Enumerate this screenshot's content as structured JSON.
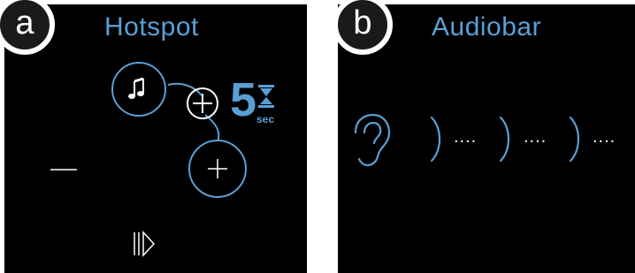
{
  "panel_a": {
    "badge": "a",
    "title": "Hotspot",
    "timer_value": "5",
    "timer_unit": "sec",
    "icons": [
      "music-note-icon",
      "plus-icon",
      "plus-icon",
      "minus-icon",
      "skip-next-icon",
      "hourglass-icon"
    ]
  },
  "panel_b": {
    "badge": "b",
    "title": "Audiobar",
    "dots": [
      "....",
      "....",
      "...."
    ],
    "icons": [
      "ear-icon",
      "sound-wave-icon"
    ]
  },
  "colors": {
    "accent": "#5a9fd4",
    "background": "#000000",
    "foreground": "#ffffff"
  }
}
